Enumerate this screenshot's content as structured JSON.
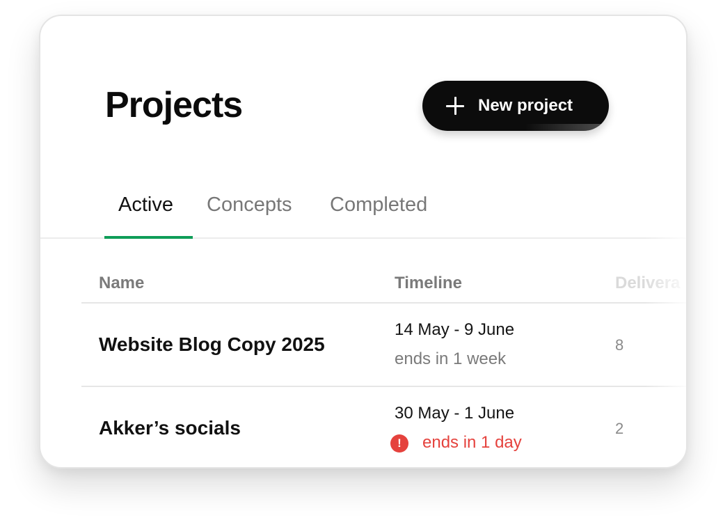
{
  "header": {
    "title": "Projects",
    "new_project_label": "New project"
  },
  "tabs": [
    {
      "label": "Active",
      "active": true
    },
    {
      "label": "Concepts",
      "active": false
    },
    {
      "label": "Completed",
      "active": false
    }
  ],
  "table": {
    "columns": [
      "Name",
      "Timeline",
      "Delivera"
    ],
    "rows": [
      {
        "name": "Website Blog Copy 2025",
        "timeline_range": "14 May - 9 June",
        "timeline_status": "ends in 1 week",
        "urgent": false,
        "deliverables": "8"
      },
      {
        "name": "Akker’s socials",
        "timeline_range": "30 May - 1 June",
        "timeline_status": "ends in 1 day",
        "urgent": true,
        "deliverables": "2"
      }
    ]
  },
  "colors": {
    "accent": "#0f9d58",
    "urgent": "#e5423d",
    "button_bg": "#0c0c0c"
  },
  "icons": {
    "new_project": "plus-icon",
    "urgent": "alert-icon"
  }
}
